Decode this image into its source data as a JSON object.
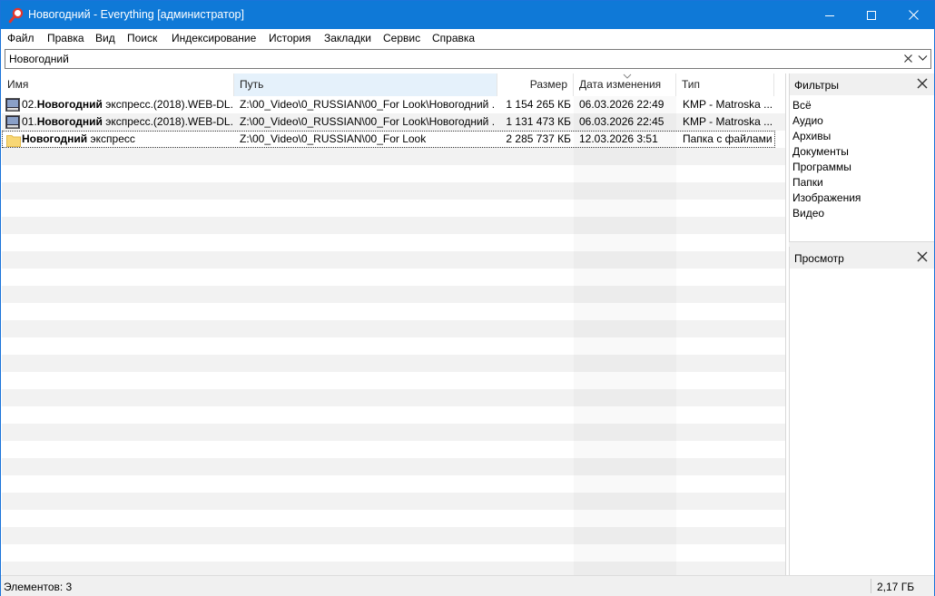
{
  "window": {
    "title": "Новогодний - Everything [администратор]",
    "accent": "#0f79d7"
  },
  "menu": [
    "Файл",
    "Правка",
    "Вид",
    "Поиск",
    "Индексирование",
    "История",
    "Закладки",
    "Сервис",
    "Справка"
  ],
  "search": {
    "value": "Новогодний",
    "placeholder": ""
  },
  "columns": {
    "name": "Имя",
    "path": "Путь",
    "size": "Размер",
    "date": "Дата изменения",
    "type": "Тип"
  },
  "rows": [
    {
      "icon": "video-file-icon",
      "name_prefix": "02.",
      "name_match": "Новогодний",
      "name_rest": " экспресс.(2018).WEB-DL...",
      "path": "Z:\\00_Video\\0_RUSSIAN\\00_For Look\\Новогодний ...",
      "size": "1 154 265 КБ",
      "date": "06.03.2026 22:49",
      "type": "KMP - Matroska ..."
    },
    {
      "icon": "video-file-icon",
      "name_prefix": "01.",
      "name_match": "Новогодний",
      "name_rest": " экспресс.(2018).WEB-DL...",
      "path": "Z:\\00_Video\\0_RUSSIAN\\00_For Look\\Новогодний ...",
      "size": "1 131 473 КБ",
      "date": "06.03.2026 22:45",
      "type": "KMP - Matroska ..."
    },
    {
      "icon": "folder-icon",
      "name_prefix": "",
      "name_match": "Новогодний",
      "name_rest": " экспресс",
      "path": "Z:\\00_Video\\0_RUSSIAN\\00_For Look",
      "size": "2 285 737 КБ",
      "date": "12.03.2026 3:51",
      "type": "Папка с файлами"
    }
  ],
  "filters": {
    "title": "Фильтры",
    "items": [
      "Всё",
      "Аудио",
      "Архивы",
      "Документы",
      "Программы",
      "Папки",
      "Изображения",
      "Видео"
    ]
  },
  "preview": {
    "title": "Просмотр"
  },
  "status": {
    "items_count": "Элементов: 3",
    "total_size": "2,17 ГБ"
  }
}
